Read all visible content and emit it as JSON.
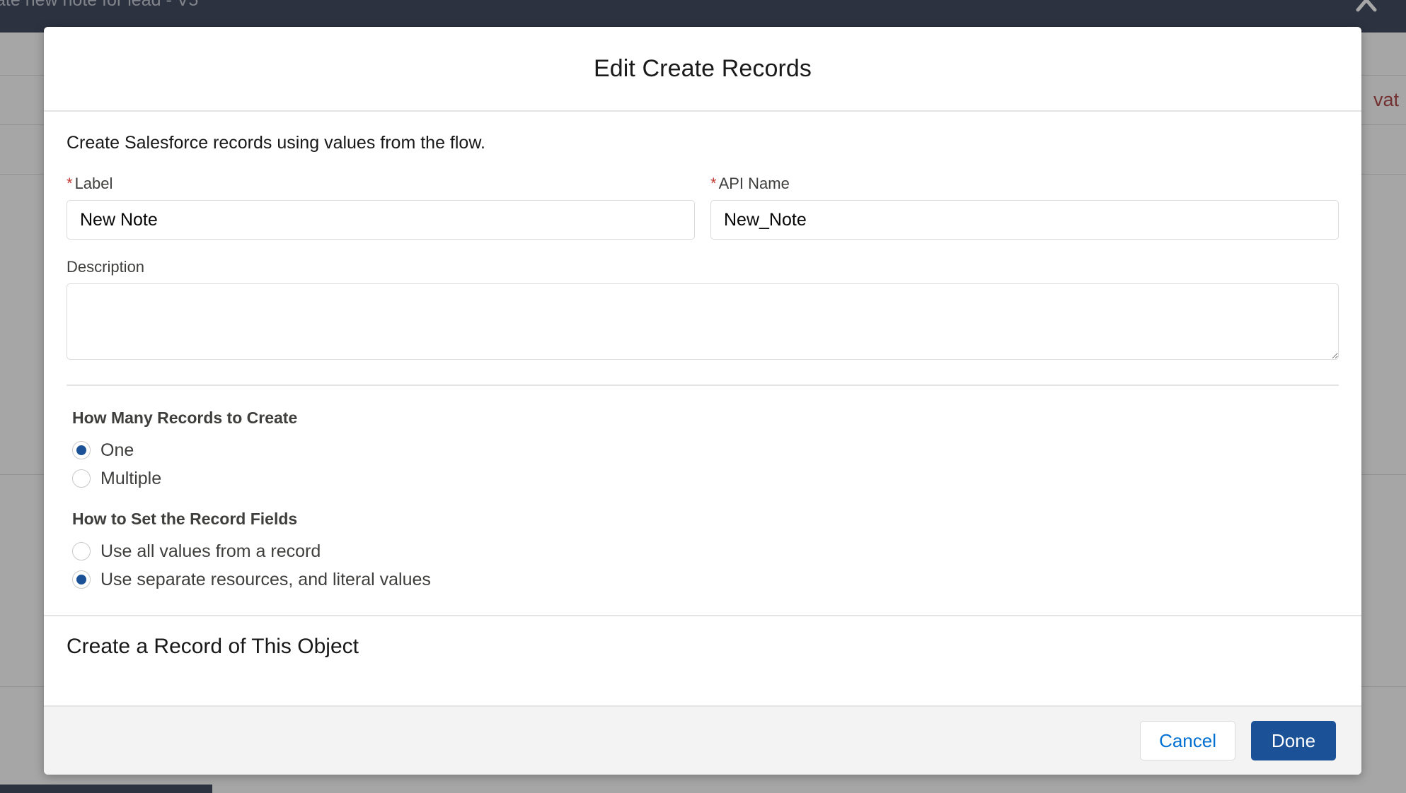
{
  "background": {
    "topbar_title": "ate new note for lead - V5",
    "collapse_icon": "chevron-up-icon",
    "activate_text": "vat",
    "overlay_color": "#464646",
    "topbar_color": "#16213d"
  },
  "modal": {
    "title": "Edit Create Records",
    "intro": "Create Salesforce records using values from the flow.",
    "fields": {
      "label": {
        "label": "Label",
        "required_marker": "*",
        "value": "New Note",
        "placeholder": ""
      },
      "api_name": {
        "label": "API Name",
        "required_marker": "*",
        "value": "New_Note",
        "placeholder": ""
      },
      "description": {
        "label": "Description",
        "value": "",
        "placeholder": ""
      }
    },
    "radio_groups": [
      {
        "legend": "How Many Records to Create",
        "options": [
          {
            "label": "One",
            "selected": true
          },
          {
            "label": "Multiple",
            "selected": false
          }
        ]
      },
      {
        "legend": "How to Set the Record Fields",
        "options": [
          {
            "label": "Use all values from a record",
            "selected": false
          },
          {
            "label": "Use separate resources, and literal values",
            "selected": true
          }
        ]
      }
    ],
    "object_section": {
      "heading": "Create a Record of This Object"
    },
    "footer": {
      "cancel_label": "Cancel",
      "done_label": "Done",
      "brand_color": "#1b5297",
      "link_color": "#0070d2"
    }
  }
}
